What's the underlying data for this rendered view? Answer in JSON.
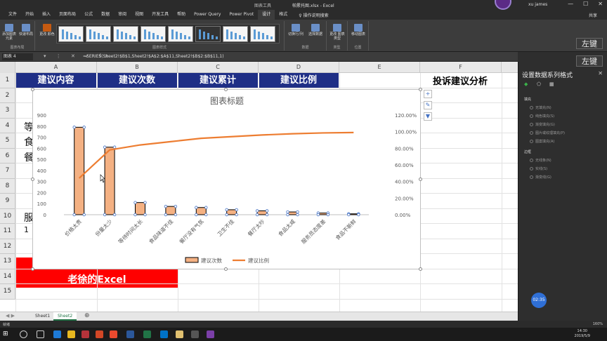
{
  "titlebar": {
    "tools_label": "图表工具",
    "doc_title": "帕累托图.xlsx  -  Excel",
    "user": "xu james",
    "min": "—",
    "max": "☐",
    "close": "✕"
  },
  "tabs": [
    "文件",
    "开始",
    "插入",
    "页面布局",
    "公式",
    "数据",
    "审阅",
    "视图",
    "开发工具",
    "帮助",
    "Power Query",
    "Power Pivot",
    "设计",
    "格式"
  ],
  "active_tab": "设计",
  "tellme": "操作说明搜索",
  "share": "共享",
  "ribbon": {
    "add_element": "添加图表\n元素",
    "quick_layout": "快速布局",
    "change_colors": "更改\n颜色",
    "layout_group": "图表布局",
    "styles_group": "图表样式",
    "switch_rowcol": "切换行/列",
    "select_data": "选择数据",
    "data_group": "数据",
    "change_type": "更改\n图表类型",
    "type_group": "类型",
    "move_chart": "移动图表",
    "location_group": "位置"
  },
  "namebox": "图表 4",
  "formula_icons": "▾ ⋮ ✕ ✓ fx",
  "formula": "=SERIES(Sheet2!$B$1,Sheet2!$A$2:$A$11,Sheet2!$B$2:$B$11,1)",
  "columns": [
    "A",
    "B",
    "C",
    "D",
    "E",
    "F"
  ],
  "rows": [
    "1",
    "2",
    "3",
    "4",
    "5",
    "6",
    "7",
    "8",
    "9",
    "10",
    "11",
    "12",
    "13",
    "14",
    "15"
  ],
  "header_cells": [
    "建议内容",
    "建议次数",
    "建议累计",
    "建议比例"
  ],
  "f1_text": "投诉建议分析",
  "partial_chars": [
    "等",
    "食",
    "餐",
    "服",
    "1"
  ],
  "banner_text": "老徐的Excel",
  "chart_data": {
    "type": "bar",
    "title": "图表标题",
    "categories": [
      "价格太贵",
      "份量太少",
      "等待时间太长",
      "食品味道不佳",
      "餐厅没有气氛",
      "卫生不佳",
      "餐厅太吵",
      "食品太咸",
      "服务员态度差",
      "食品不新鲜"
    ],
    "series": [
      {
        "name": "建议次数",
        "type": "bar",
        "axis": "left",
        "values": [
          790,
          610,
          110,
          75,
          65,
          45,
          35,
          25,
          15,
          8
        ]
      },
      {
        "name": "建议比例",
        "type": "line",
        "axis": "right",
        "values": [
          0.44,
          0.78,
          0.84,
          0.88,
          0.92,
          0.94,
          0.96,
          0.975,
          0.985,
          0.99
        ]
      }
    ],
    "y_left_ticks": [
      "0",
      "100",
      "200",
      "300",
      "400",
      "500",
      "600",
      "700",
      "800",
      "900"
    ],
    "y_right_ticks": [
      "0.00%",
      "20.00%",
      "40.00%",
      "60.00%",
      "80.00%",
      "100.00%",
      "120.00%"
    ],
    "ylim_left": [
      0,
      900
    ],
    "ylim_right": [
      0,
      1.2
    ],
    "legend_position": "bottom",
    "colors": {
      "bar_fill": "#f4b183",
      "bar_stroke": "#000000",
      "line": "#ed7d31"
    }
  },
  "sheet_tabs": [
    "Sheet1",
    "Sheet2"
  ],
  "active_sheet": "Sheet2",
  "status": {
    "ready": "就绪",
    "zoom": "160%"
  },
  "clock": {
    "time": "14:30",
    "date": "2019/5/9"
  },
  "pane": {
    "title": "设置数据系列格式",
    "fill_section": "填充",
    "fill_options": [
      "无填充(N)",
      "纯色填充(S)",
      "渐变填充(G)",
      "图片或纹理填充(P)",
      "图案填充(A)"
    ],
    "border_section": "边框",
    "border_options": [
      "无线条(N)",
      "实线(S)",
      "渐变线(G)"
    ]
  },
  "timer": "02:35",
  "key_labels": [
    "左键",
    "左键"
  ]
}
